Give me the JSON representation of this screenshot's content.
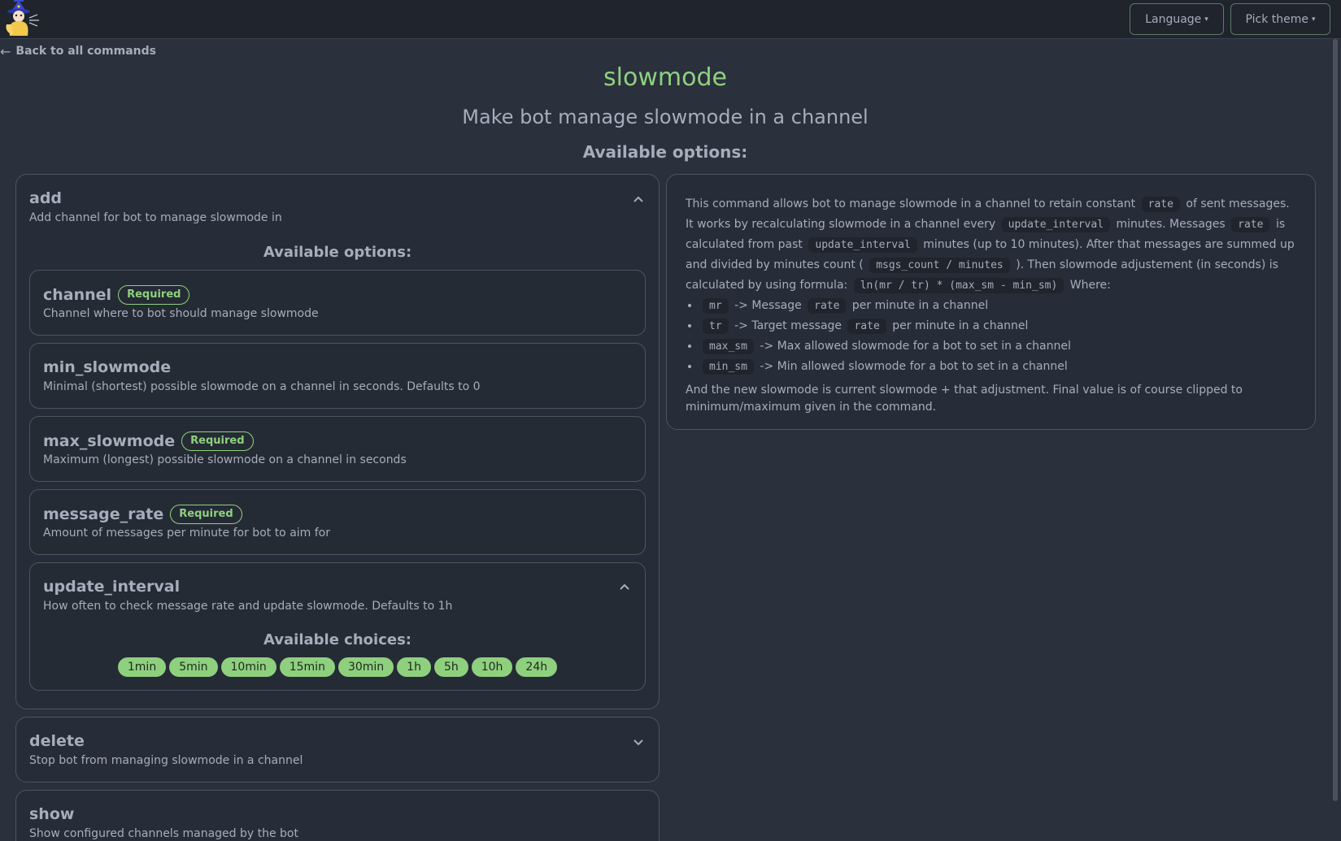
{
  "nav": {
    "language_label": "Language",
    "theme_label": "Pick theme",
    "back_label": "Back to all commands"
  },
  "command": {
    "name": "slowmode",
    "description": "Make bot manage slowmode in a channel",
    "options_heading": "Available options:"
  },
  "subcommands": [
    {
      "name": "add",
      "description": "Add channel for bot to manage slowmode in",
      "options_heading": "Available options:",
      "options": [
        {
          "name": "channel",
          "required_label": "Required",
          "description": "Channel where to bot should manage slowmode"
        },
        {
          "name": "min_slowmode",
          "description": "Minimal (shortest) possible slowmode on a channel in seconds. Defaults to 0"
        },
        {
          "name": "max_slowmode",
          "required_label": "Required",
          "description": "Maximum (longest) possible slowmode on a channel in seconds"
        },
        {
          "name": "message_rate",
          "required_label": "Required",
          "description": "Amount of messages per minute for bot to aim for"
        },
        {
          "name": "update_interval",
          "description": "How often to check message rate and update slowmode. Defaults to 1h",
          "choices_heading": "Available choices:",
          "choices": [
            "1min",
            "5min",
            "10min",
            "15min",
            "30min",
            "1h",
            "5h",
            "10h",
            "24h"
          ]
        }
      ]
    },
    {
      "name": "delete",
      "description": "Stop bot from managing slowmode in a channel"
    },
    {
      "name": "show",
      "description": "Show configured channels managed by the bot"
    }
  ],
  "details": {
    "p1": [
      "This command allows bot to manage slowmode in a channel to retain constant",
      "rate",
      "of sent messages. It works by recalculating slowmode in a channel every",
      "update_interval",
      "minutes. Messages",
      "rate",
      "is calculated from past",
      "update_interval",
      "minutes (up to 10 minutes). After that messages are summed up and divided by minutes count (",
      "msgs_count / minutes",
      "). Then slowmode adjustement (in seconds) is calculated by using formula:",
      "ln(mr / tr) * (max_sm - min_sm)",
      "Where:"
    ],
    "bullets": [
      {
        "code": "mr",
        "pre": "-> Message",
        "code2": "rate",
        "post": "per minute in a channel"
      },
      {
        "code": "tr",
        "pre": "-> Target message",
        "code2": "rate",
        "post": "per minute in a channel"
      },
      {
        "code": "max_sm",
        "pre": "-> Max allowed slowmode for a bot to set in a channel"
      },
      {
        "code": "min_sm",
        "pre": "-> Min allowed slowmode for a bot to set in a channel"
      }
    ],
    "final": "And the new slowmode is current slowmode + that adjustment. Final value is of course clipped to minimum/maximum given in the command."
  },
  "colors": {
    "accent": "#8fd07f",
    "background": "#2a303c",
    "text": "#a6adbb"
  }
}
